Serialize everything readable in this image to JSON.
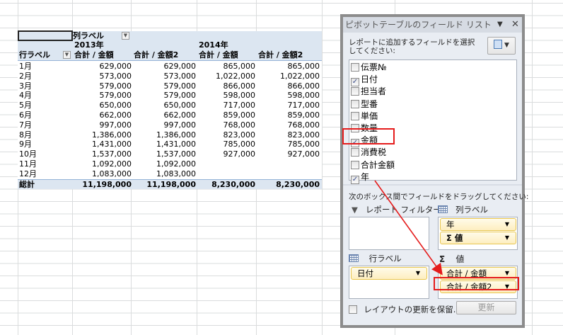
{
  "pivot": {
    "col_label": "列ラベル",
    "row_label": "行ラベル",
    "years": [
      "2013年",
      "2014年"
    ],
    "headers": [
      "合計 / 金額",
      "合計 / 金額2",
      "合計 / 金額",
      "合計 / 金額2"
    ],
    "rows": [
      {
        "label": "1月",
        "values": [
          "629,000",
          "629,000",
          "865,000",
          "865,000"
        ]
      },
      {
        "label": "2月",
        "values": [
          "573,000",
          "573,000",
          "1,022,000",
          "1,022,000"
        ]
      },
      {
        "label": "3月",
        "values": [
          "579,000",
          "579,000",
          "866,000",
          "866,000"
        ]
      },
      {
        "label": "4月",
        "values": [
          "579,000",
          "579,000",
          "598,000",
          "598,000"
        ]
      },
      {
        "label": "5月",
        "values": [
          "650,000",
          "650,000",
          "717,000",
          "717,000"
        ]
      },
      {
        "label": "6月",
        "values": [
          "662,000",
          "662,000",
          "859,000",
          "859,000"
        ]
      },
      {
        "label": "7月",
        "values": [
          "997,000",
          "997,000",
          "768,000",
          "768,000"
        ]
      },
      {
        "label": "8月",
        "values": [
          "1,386,000",
          "1,386,000",
          "823,000",
          "823,000"
        ]
      },
      {
        "label": "9月",
        "values": [
          "1,431,000",
          "1,431,000",
          "785,000",
          "785,000"
        ]
      },
      {
        "label": "10月",
        "values": [
          "1,537,000",
          "1,537,000",
          "927,000",
          "927,000"
        ]
      },
      {
        "label": "11月",
        "values": [
          "1,092,000",
          "1,092,000",
          "",
          ""
        ]
      },
      {
        "label": "12月",
        "values": [
          "1,083,000",
          "1,083,000",
          "",
          ""
        ]
      }
    ],
    "total": {
      "label": "総計",
      "values": [
        "11,198,000",
        "11,198,000",
        "8,230,000",
        "8,230,000"
      ]
    }
  },
  "panel": {
    "title": "ピボットテーブルのフィールド リスト",
    "instruction": "レポートに追加するフィールドを選択してください:",
    "fields": [
      {
        "label": "伝票№",
        "checked": false
      },
      {
        "label": "日付",
        "checked": true
      },
      {
        "label": "担当者",
        "checked": false
      },
      {
        "label": "型番",
        "checked": false
      },
      {
        "label": "単価",
        "checked": false
      },
      {
        "label": "数量",
        "checked": false
      },
      {
        "label": "金額",
        "checked": true
      },
      {
        "label": "消費税",
        "checked": false
      },
      {
        "label": "合計金額",
        "checked": false
      },
      {
        "label": "年",
        "checked": true
      }
    ],
    "drag_instruction": "次のボックス間でフィールドをドラッグしてください:",
    "report_filter": "レポート フィルター",
    "column_labels": "列ラベル",
    "row_labels": "行ラベル",
    "values": "値",
    "column_items": [
      "年",
      "Σ 値"
    ],
    "row_items": [
      "日付"
    ],
    "value_items": [
      "合計 / 金額",
      "合計 / 金額2"
    ],
    "defer_label": "レイアウトの更新を保留...",
    "update_button": "更新"
  },
  "colors": {
    "pivot_header": "#dce6f1",
    "highlight": "#e51c1c",
    "chip": "#fdeec0"
  }
}
